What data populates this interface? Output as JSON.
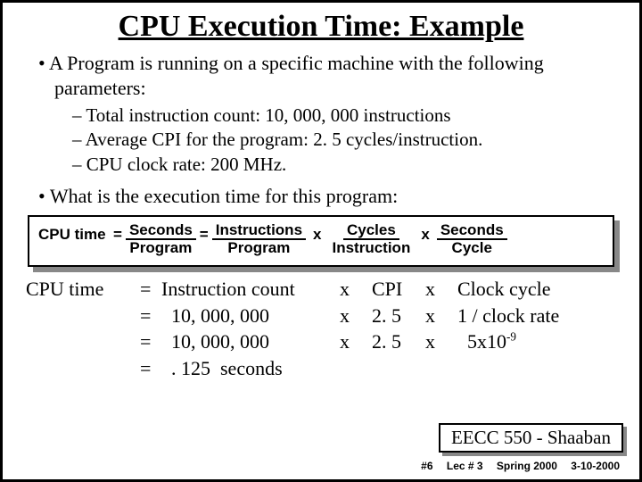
{
  "title": "CPU Execution Time: Example",
  "intro": "A Program is running on a specific machine with the following parameters:",
  "params": [
    "Total instruction count:     10, 000, 000 instructions",
    "Average CPI for the program:   2. 5  cycles/instruction.",
    "CPU clock rate:  200 MHz."
  ],
  "question": "What is the execution time for this program:",
  "formula": {
    "lhs": "CPU time",
    "eq": "=",
    "f1": {
      "num": "Seconds",
      "den": "Program"
    },
    "eq2": "=",
    "f2": {
      "num": "Instructions",
      "den": "Program"
    },
    "x1": "x",
    "f3": {
      "num": "Cycles",
      "den": "Instruction"
    },
    "x2": "x",
    "f4": {
      "num": "Seconds",
      "den": "Cycle"
    }
  },
  "calc": {
    "r1": {
      "lhs": "CPU time",
      "eq": "=",
      "a": "Instruction count",
      "b": "x",
      "c": "CPI",
      "d": "x",
      "e": "Clock cycle"
    },
    "r2": {
      "lhs": "",
      "eq": "=",
      "a": "  10, 000, 000",
      "b": "x",
      "c": "2. 5",
      "d": "x",
      "e": "1 / clock rate"
    },
    "r3": {
      "lhs": "",
      "eq": "=",
      "a": "  10, 000, 000",
      "b": "x",
      "c": "2. 5",
      "d": "x",
      "e_pre": "  5x10",
      "e_sup": "-9"
    },
    "r4": {
      "lhs": "",
      "eq": "=",
      "a": "  . 125  seconds"
    }
  },
  "footer": "EECC 550 - Shaaban",
  "meta": {
    "a": "#6",
    "b": "Lec # 3",
    "c": "Spring 2000",
    "d": "3-10-2000"
  }
}
